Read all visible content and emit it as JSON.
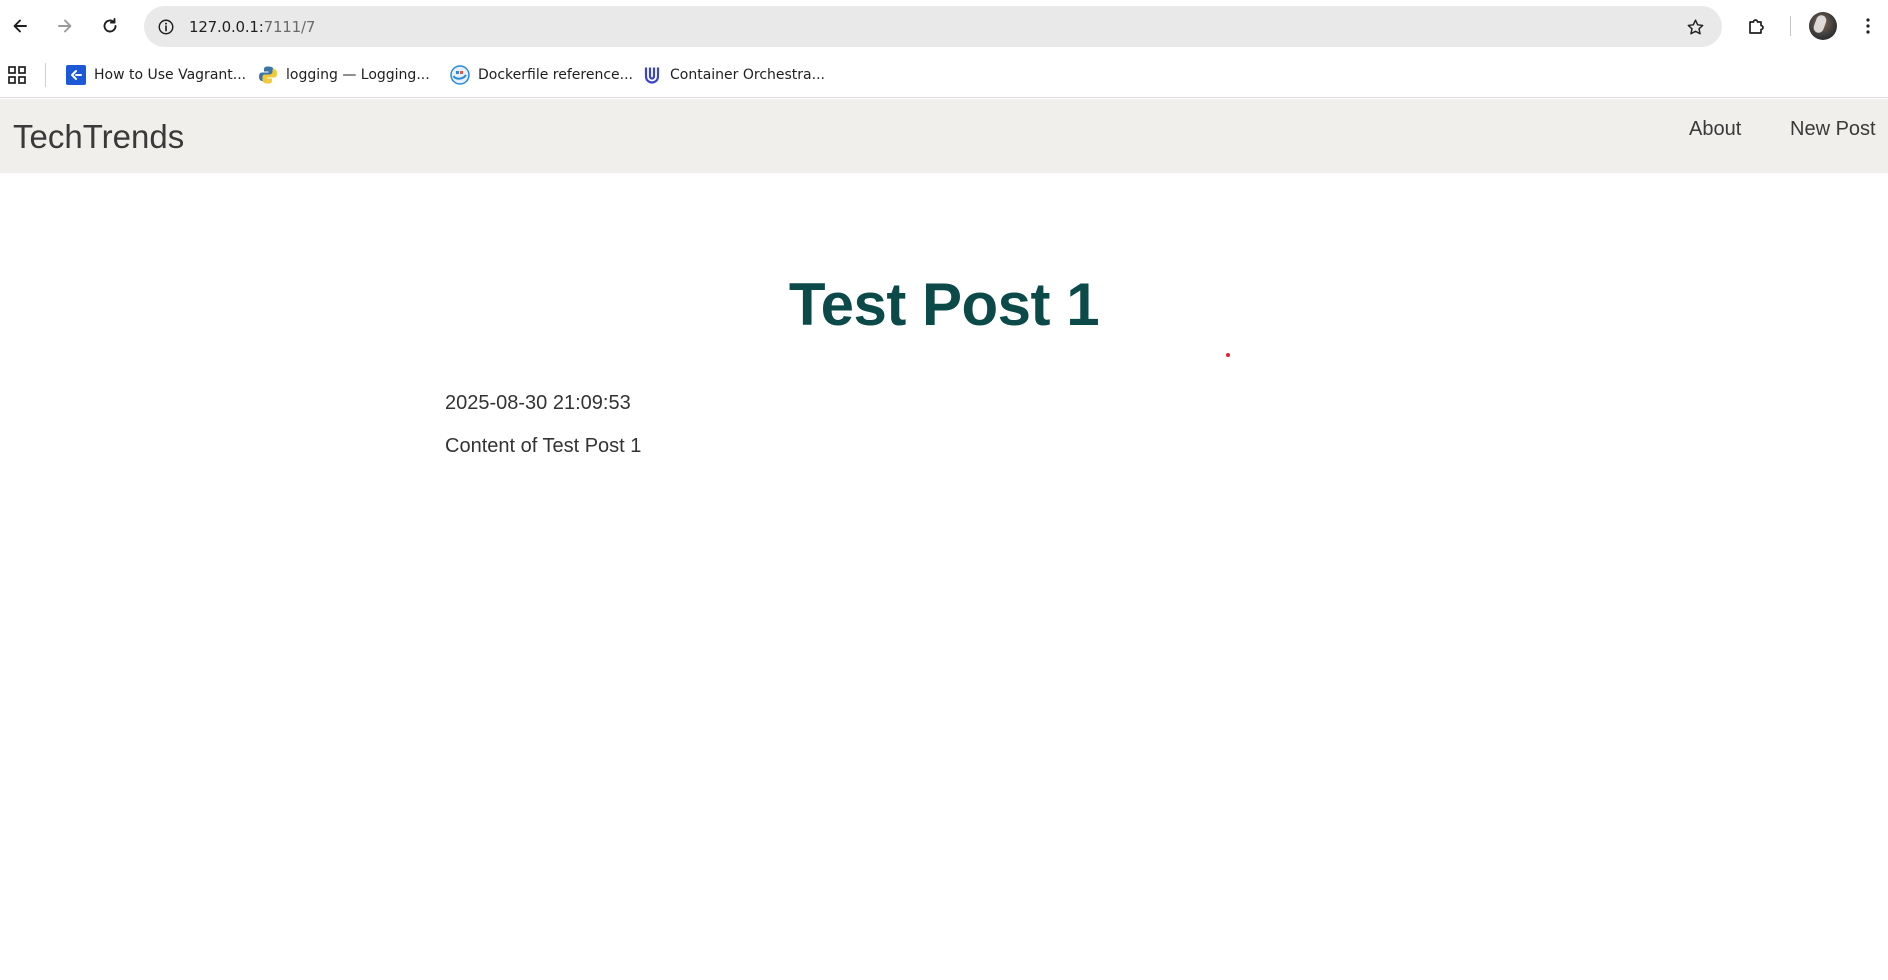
{
  "browser": {
    "url_host": "127.0.0.1:",
    "url_path": "7111/7",
    "bookmarks": [
      {
        "label": "How to Use Vagrant...",
        "icon": "vagrant-icon"
      },
      {
        "label": "logging — Logging...",
        "icon": "python-icon"
      },
      {
        "label": "Dockerfile reference...",
        "icon": "docker-icon"
      },
      {
        "label": "Container Orchestra...",
        "icon": "udacity-icon"
      }
    ]
  },
  "site": {
    "brand": "TechTrends",
    "nav": {
      "about": "About",
      "new_post": "New Post"
    },
    "colors": {
      "navbar_bg": "#f0efeb",
      "title": "#0c4a49"
    }
  },
  "post": {
    "title": "Test Post 1",
    "created": "2025-08-30 21:09:53",
    "content": "Content of Test Post 1"
  }
}
